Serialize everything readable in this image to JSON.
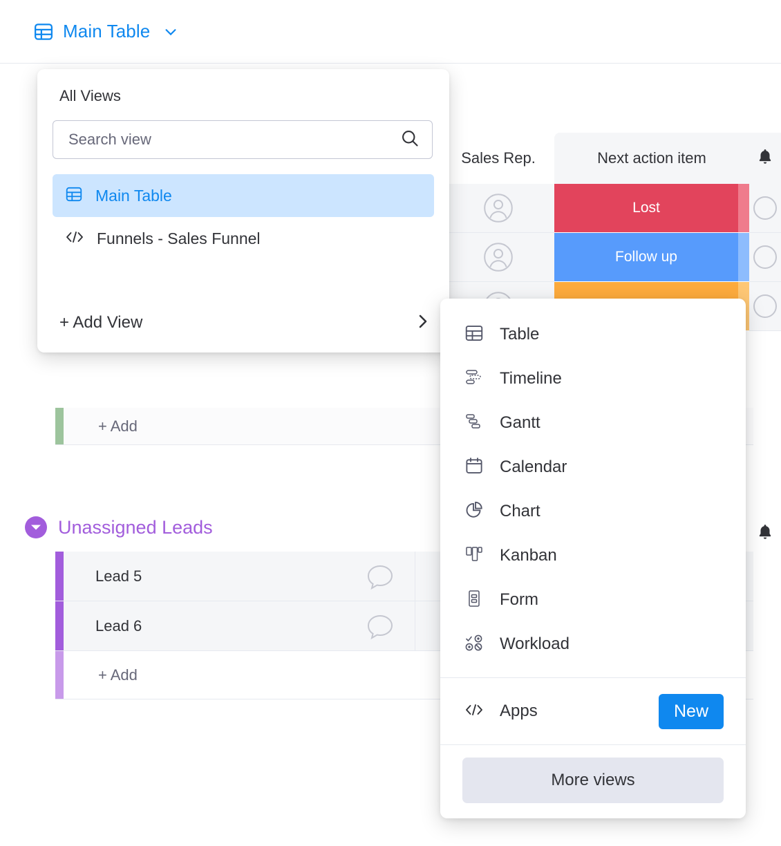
{
  "topbar": {
    "view_name": "Main Table",
    "table_icon": "table-icon",
    "chevron_icon": "chevron-down-icon",
    "accent_color": "#0f88ef"
  },
  "views_panel": {
    "title": "All Views",
    "search": {
      "placeholder": "Search view",
      "value": "",
      "icon": "search-icon"
    },
    "items": [
      {
        "label": "Main Table",
        "icon": "table-icon",
        "selected": true
      },
      {
        "label": "Funnels - Sales Funnel",
        "icon": "code-icon",
        "selected": false
      }
    ],
    "add_view": {
      "label": "+ Add View",
      "icon": "chevron-right-icon"
    },
    "selected_bg": "#cce5ff"
  },
  "submenu": {
    "items": [
      {
        "label": "Table",
        "icon": "table-icon"
      },
      {
        "label": "Timeline",
        "icon": "timeline-icon"
      },
      {
        "label": "Gantt",
        "icon": "gantt-icon"
      },
      {
        "label": "Calendar",
        "icon": "calendar-icon"
      },
      {
        "label": "Chart",
        "icon": "chart-pie-icon"
      },
      {
        "label": "Kanban",
        "icon": "kanban-icon"
      },
      {
        "label": "Form",
        "icon": "form-icon"
      },
      {
        "label": "Workload",
        "icon": "workload-icon"
      }
    ],
    "apps": {
      "label": "Apps",
      "icon": "code-icon",
      "badge": "New",
      "badge_color": "#0f88ef"
    },
    "more_views": {
      "label": "More views"
    }
  },
  "board": {
    "columns": [
      {
        "label": "Sales Rep."
      },
      {
        "label": "Next action item"
      },
      {
        "label": "",
        "icon": "bell-icon"
      }
    ],
    "group_green": {
      "color": "#7ab87a",
      "rows": [
        {
          "person_icon": "avatar-icon",
          "status": "Lost",
          "status_color": "#e2445c",
          "check_icon": "circle-icon"
        },
        {
          "person_icon": "avatar-icon",
          "status": "Follow up",
          "status_color": "#579bfc",
          "check_icon": "circle-icon"
        },
        {
          "person_icon": "avatar-icon",
          "status": "",
          "status_color": "#fdab3d",
          "check_icon": "circle-icon"
        }
      ],
      "add_label": "+ Add"
    },
    "group_unassigned": {
      "title": "Unassigned Leads",
      "color": "#a25ddc",
      "collapse_icon": "chevron-down-circle-icon",
      "rows": [
        {
          "name": "Lead 5",
          "comment_icon": "comment-icon"
        },
        {
          "name": "Lead 6",
          "comment_icon": "comment-icon"
        }
      ],
      "add_label": "+ Add",
      "bell_icon": "bell-icon"
    }
  }
}
